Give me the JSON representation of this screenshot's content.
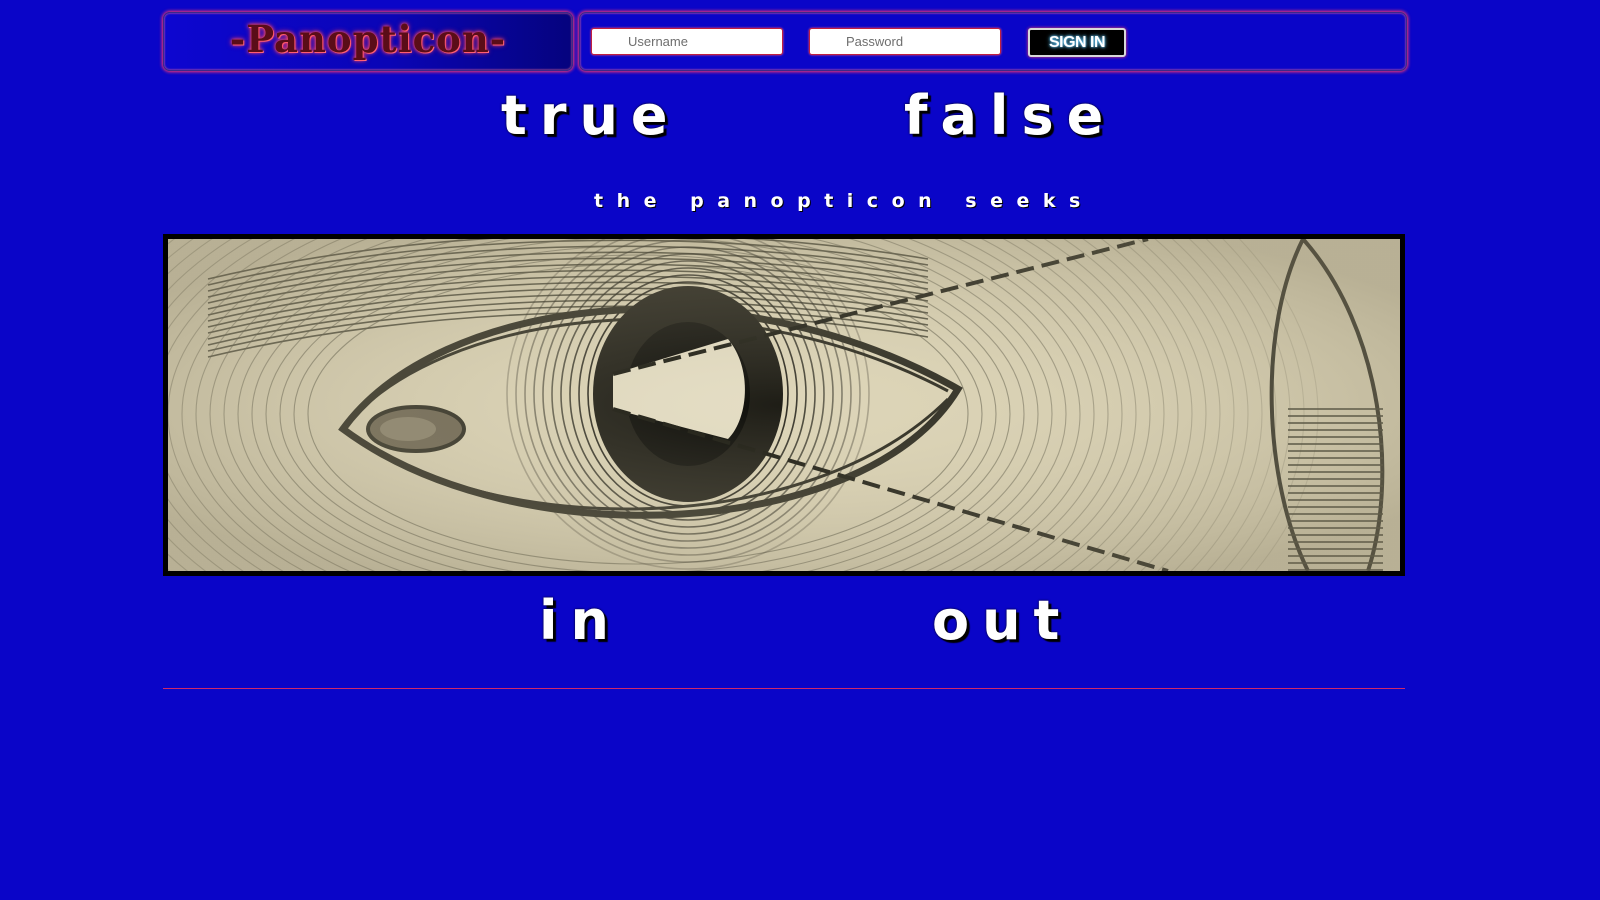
{
  "header": {
    "logo": "-Panopticon-",
    "username_placeholder": "Username",
    "password_placeholder": "Password",
    "signin_label": "SIGN IN"
  },
  "words": {
    "top_left": "true",
    "top_right": "false",
    "bottom_left": "in",
    "bottom_right": "out"
  },
  "tagline": "the panopticon seeks",
  "colors": {
    "background": "#0a05c8",
    "accent_glow": "#ff3a6a",
    "illustration_paper": "#d9d1b3"
  },
  "icons": {
    "illustration": "engraved-eye-illustration"
  }
}
